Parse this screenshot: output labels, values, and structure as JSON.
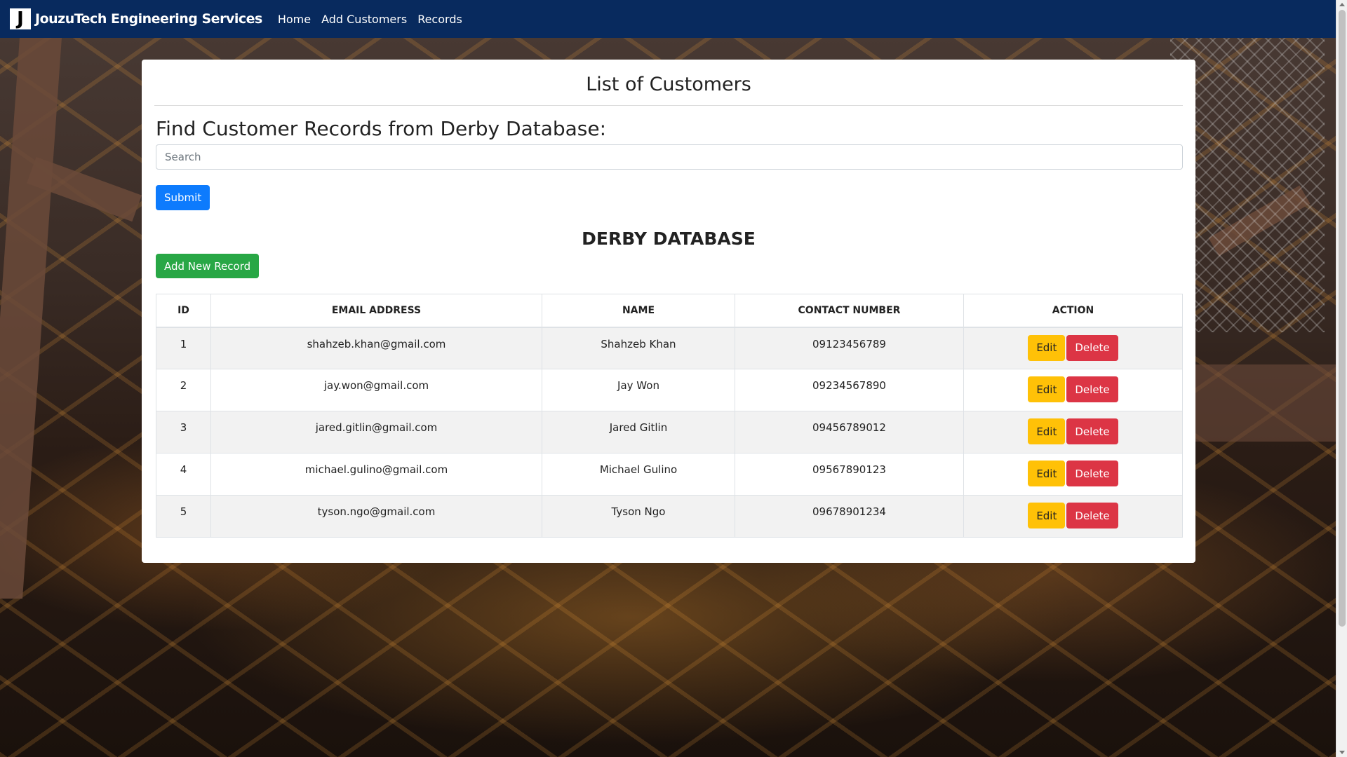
{
  "navbar": {
    "logo_letter": "J",
    "brand": "JouzuTech Engineering Services",
    "links": [
      "Home",
      "Add Customers",
      "Records"
    ]
  },
  "card": {
    "title": "List of Customers",
    "find_heading": "Find Customer Records from Derby Database:",
    "search_placeholder": "Search",
    "submit_label": "Submit",
    "db_title": "DERBY DATABASE",
    "add_label": "Add New Record"
  },
  "table": {
    "headers": [
      "ID",
      "EMAIL ADDRESS",
      "NAME",
      "CONTACT NUMBER",
      "ACTION"
    ],
    "rows": [
      {
        "id": "1",
        "email": "shahzeb.khan@gmail.com",
        "name": "Shahzeb Khan",
        "contact": "09123456789"
      },
      {
        "id": "2",
        "email": "jay.won@gmail.com",
        "name": "Jay Won",
        "contact": "09234567890"
      },
      {
        "id": "3",
        "email": "jared.gitlin@gmail.com",
        "name": "Jared Gitlin",
        "contact": "09456789012"
      },
      {
        "id": "4",
        "email": "michael.gulino@gmail.com",
        "name": "Michael Gulino",
        "contact": "09567890123"
      },
      {
        "id": "5",
        "email": "tyson.ngo@gmail.com",
        "name": "Tyson Ngo",
        "contact": "09678901234"
      }
    ],
    "edit_label": "Edit",
    "delete_label": "Delete"
  },
  "colors": {
    "navbar": "#082a5e",
    "submit": "#0d7bfd",
    "add": "#28a745",
    "edit": "#ffc107",
    "delete": "#dc3545"
  }
}
